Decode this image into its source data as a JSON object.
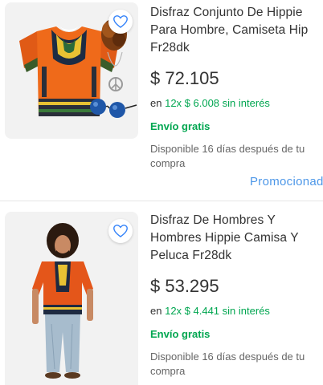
{
  "products": [
    {
      "title": "Disfraz Conjunto De Hippie Para Hombre, Camiseta Hip Fr28dk",
      "price": "$ 72.105",
      "installments_prefix": "en",
      "installments_detail": "12x $ 6.008",
      "installments_suffix": "sin interés",
      "shipping": "Envío gratis",
      "availability": "Disponible 16 días después de tu compra",
      "promoted_label": "Promocionado",
      "image": "hippie-shirt-wig-peace-necklace-glasses"
    },
    {
      "title": "Disfraz De Hombres Y Hombres Hippie Camisa Y Peluca Fr28dk",
      "price": "$ 53.295",
      "installments_prefix": "en",
      "installments_detail": "12x $ 4.441",
      "installments_suffix": "sin interés",
      "shipping": "Envío gratis",
      "availability": "Disponible 16 días después de tu compra",
      "image": "man-in-hippie-costume"
    }
  ],
  "colors": {
    "green": "#00a650",
    "link_blue": "#4d97e8",
    "heart_blue": "#3483fa",
    "text": "#333333",
    "muted": "#666666"
  },
  "icons": {
    "favorite": "heart-icon"
  }
}
